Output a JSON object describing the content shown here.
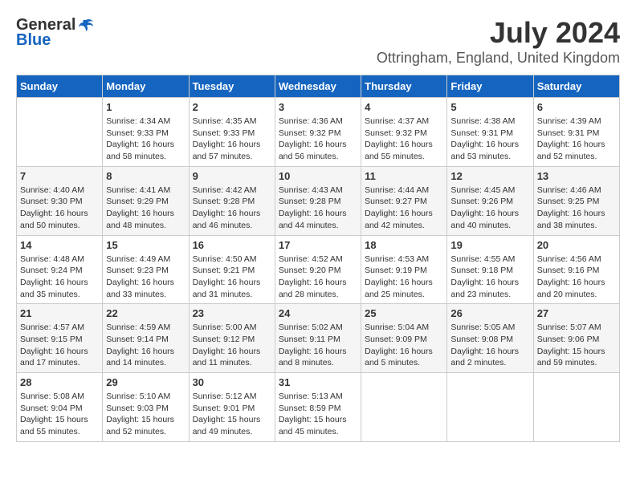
{
  "header": {
    "logo_general": "General",
    "logo_blue": "Blue",
    "month": "July 2024",
    "location": "Ottringham, England, United Kingdom"
  },
  "weekdays": [
    "Sunday",
    "Monday",
    "Tuesday",
    "Wednesday",
    "Thursday",
    "Friday",
    "Saturday"
  ],
  "weeks": [
    [
      {
        "day": "",
        "info": ""
      },
      {
        "day": "1",
        "info": "Sunrise: 4:34 AM\nSunset: 9:33 PM\nDaylight: 16 hours\nand 58 minutes."
      },
      {
        "day": "2",
        "info": "Sunrise: 4:35 AM\nSunset: 9:33 PM\nDaylight: 16 hours\nand 57 minutes."
      },
      {
        "day": "3",
        "info": "Sunrise: 4:36 AM\nSunset: 9:32 PM\nDaylight: 16 hours\nand 56 minutes."
      },
      {
        "day": "4",
        "info": "Sunrise: 4:37 AM\nSunset: 9:32 PM\nDaylight: 16 hours\nand 55 minutes."
      },
      {
        "day": "5",
        "info": "Sunrise: 4:38 AM\nSunset: 9:31 PM\nDaylight: 16 hours\nand 53 minutes."
      },
      {
        "day": "6",
        "info": "Sunrise: 4:39 AM\nSunset: 9:31 PM\nDaylight: 16 hours\nand 52 minutes."
      }
    ],
    [
      {
        "day": "7",
        "info": "Sunrise: 4:40 AM\nSunset: 9:30 PM\nDaylight: 16 hours\nand 50 minutes."
      },
      {
        "day": "8",
        "info": "Sunrise: 4:41 AM\nSunset: 9:29 PM\nDaylight: 16 hours\nand 48 minutes."
      },
      {
        "day": "9",
        "info": "Sunrise: 4:42 AM\nSunset: 9:28 PM\nDaylight: 16 hours\nand 46 minutes."
      },
      {
        "day": "10",
        "info": "Sunrise: 4:43 AM\nSunset: 9:28 PM\nDaylight: 16 hours\nand 44 minutes."
      },
      {
        "day": "11",
        "info": "Sunrise: 4:44 AM\nSunset: 9:27 PM\nDaylight: 16 hours\nand 42 minutes."
      },
      {
        "day": "12",
        "info": "Sunrise: 4:45 AM\nSunset: 9:26 PM\nDaylight: 16 hours\nand 40 minutes."
      },
      {
        "day": "13",
        "info": "Sunrise: 4:46 AM\nSunset: 9:25 PM\nDaylight: 16 hours\nand 38 minutes."
      }
    ],
    [
      {
        "day": "14",
        "info": "Sunrise: 4:48 AM\nSunset: 9:24 PM\nDaylight: 16 hours\nand 35 minutes."
      },
      {
        "day": "15",
        "info": "Sunrise: 4:49 AM\nSunset: 9:23 PM\nDaylight: 16 hours\nand 33 minutes."
      },
      {
        "day": "16",
        "info": "Sunrise: 4:50 AM\nSunset: 9:21 PM\nDaylight: 16 hours\nand 31 minutes."
      },
      {
        "day": "17",
        "info": "Sunrise: 4:52 AM\nSunset: 9:20 PM\nDaylight: 16 hours\nand 28 minutes."
      },
      {
        "day": "18",
        "info": "Sunrise: 4:53 AM\nSunset: 9:19 PM\nDaylight: 16 hours\nand 25 minutes."
      },
      {
        "day": "19",
        "info": "Sunrise: 4:55 AM\nSunset: 9:18 PM\nDaylight: 16 hours\nand 23 minutes."
      },
      {
        "day": "20",
        "info": "Sunrise: 4:56 AM\nSunset: 9:16 PM\nDaylight: 16 hours\nand 20 minutes."
      }
    ],
    [
      {
        "day": "21",
        "info": "Sunrise: 4:57 AM\nSunset: 9:15 PM\nDaylight: 16 hours\nand 17 minutes."
      },
      {
        "day": "22",
        "info": "Sunrise: 4:59 AM\nSunset: 9:14 PM\nDaylight: 16 hours\nand 14 minutes."
      },
      {
        "day": "23",
        "info": "Sunrise: 5:00 AM\nSunset: 9:12 PM\nDaylight: 16 hours\nand 11 minutes."
      },
      {
        "day": "24",
        "info": "Sunrise: 5:02 AM\nSunset: 9:11 PM\nDaylight: 16 hours\nand 8 minutes."
      },
      {
        "day": "25",
        "info": "Sunrise: 5:04 AM\nSunset: 9:09 PM\nDaylight: 16 hours\nand 5 minutes."
      },
      {
        "day": "26",
        "info": "Sunrise: 5:05 AM\nSunset: 9:08 PM\nDaylight: 16 hours\nand 2 minutes."
      },
      {
        "day": "27",
        "info": "Sunrise: 5:07 AM\nSunset: 9:06 PM\nDaylight: 15 hours\nand 59 minutes."
      }
    ],
    [
      {
        "day": "28",
        "info": "Sunrise: 5:08 AM\nSunset: 9:04 PM\nDaylight: 15 hours\nand 55 minutes."
      },
      {
        "day": "29",
        "info": "Sunrise: 5:10 AM\nSunset: 9:03 PM\nDaylight: 15 hours\nand 52 minutes."
      },
      {
        "day": "30",
        "info": "Sunrise: 5:12 AM\nSunset: 9:01 PM\nDaylight: 15 hours\nand 49 minutes."
      },
      {
        "day": "31",
        "info": "Sunrise: 5:13 AM\nSunset: 8:59 PM\nDaylight: 15 hours\nand 45 minutes."
      },
      {
        "day": "",
        "info": ""
      },
      {
        "day": "",
        "info": ""
      },
      {
        "day": "",
        "info": ""
      }
    ]
  ]
}
